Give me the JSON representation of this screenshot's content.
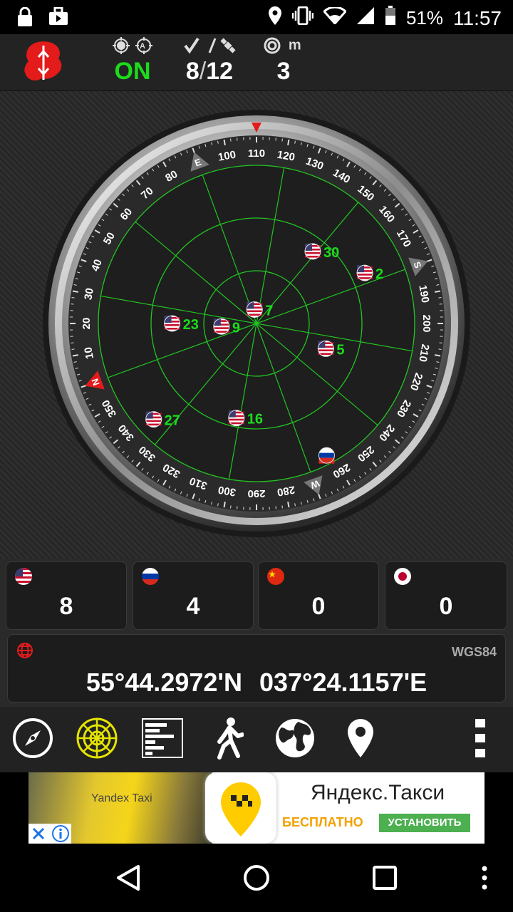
{
  "status_bar": {
    "battery_percent": "51%",
    "time": "11:57"
  },
  "header": {
    "gps_state": "ON",
    "sats_used": "8",
    "sats_sep": "/",
    "sats_visible": "12",
    "accuracy_unit": "m",
    "accuracy": "3"
  },
  "compass": {
    "dial_labels": [
      {
        "deg": 0,
        "text": "N"
      },
      {
        "deg": 10,
        "text": "10"
      },
      {
        "deg": 20,
        "text": "20"
      },
      {
        "deg": 30,
        "text": "30"
      },
      {
        "deg": 40,
        "text": "40"
      },
      {
        "deg": 50,
        "text": "50"
      },
      {
        "deg": 60,
        "text": "60"
      },
      {
        "deg": 70,
        "text": "70"
      },
      {
        "deg": 80,
        "text": "80"
      },
      {
        "deg": 90,
        "text": "E"
      },
      {
        "deg": 100,
        "text": "100"
      },
      {
        "deg": 110,
        "text": "110"
      },
      {
        "deg": 120,
        "text": "120"
      },
      {
        "deg": 130,
        "text": "130"
      },
      {
        "deg": 140,
        "text": "140"
      },
      {
        "deg": 150,
        "text": "150"
      },
      {
        "deg": 160,
        "text": "160"
      },
      {
        "deg": 170,
        "text": "170"
      },
      {
        "deg": 180,
        "text": "S"
      },
      {
        "deg": 190,
        "text": "190"
      },
      {
        "deg": 200,
        "text": "200"
      },
      {
        "deg": 210,
        "text": "210"
      },
      {
        "deg": 220,
        "text": "220"
      },
      {
        "deg": 230,
        "text": "230"
      },
      {
        "deg": 240,
        "text": "240"
      },
      {
        "deg": 250,
        "text": "250"
      },
      {
        "deg": 260,
        "text": "260"
      },
      {
        "deg": 270,
        "text": "W"
      },
      {
        "deg": 280,
        "text": "280"
      },
      {
        "deg": 290,
        "text": "290"
      },
      {
        "deg": 300,
        "text": "300"
      },
      {
        "deg": 310,
        "text": "310"
      },
      {
        "deg": 320,
        "text": "320"
      },
      {
        "deg": 330,
        "text": "330"
      },
      {
        "deg": 340,
        "text": "340"
      },
      {
        "deg": 350,
        "text": "350"
      }
    ],
    "satellites": [
      {
        "id": "27",
        "flag": "us",
        "az": 337,
        "el": 10
      },
      {
        "id": "23",
        "flag": "us",
        "az": 20,
        "el": 42
      },
      {
        "id": "16",
        "flag": "us",
        "az": 302,
        "el": 35
      },
      {
        "id": "9",
        "flag": "us",
        "az": 15,
        "el": 70
      },
      {
        "id": "7",
        "flag": "us",
        "az": 102,
        "el": 82
      },
      {
        "id": "30",
        "flag": "us",
        "az": 148,
        "el": 38
      },
      {
        "id": "5",
        "flag": "us",
        "az": 220,
        "el": 48
      },
      {
        "id": "2",
        "flag": "us",
        "az": 175,
        "el": 22
      },
      {
        "id": "",
        "flag": "ru",
        "az": 262,
        "el": 5
      }
    ]
  },
  "constellations": [
    {
      "flag": "us",
      "count": "8"
    },
    {
      "flag": "ru",
      "count": "4"
    },
    {
      "flag": "cn",
      "count": "0"
    },
    {
      "flag": "jp",
      "count": "0"
    }
  ],
  "coordinates": {
    "datum": "WGS84",
    "lat": "55°44.2972'N",
    "lon": "037°24.1157'E"
  },
  "ad": {
    "photo_caption": "Yandex Taxi",
    "title": "Яндекс.Такси",
    "free": "БЕСПЛАТНО",
    "install": "УСТАНОВИТЬ"
  },
  "colors": {
    "accent_green": "#1bdc1b",
    "grid_green": "#22c522",
    "north_red": "#e31b1b"
  }
}
